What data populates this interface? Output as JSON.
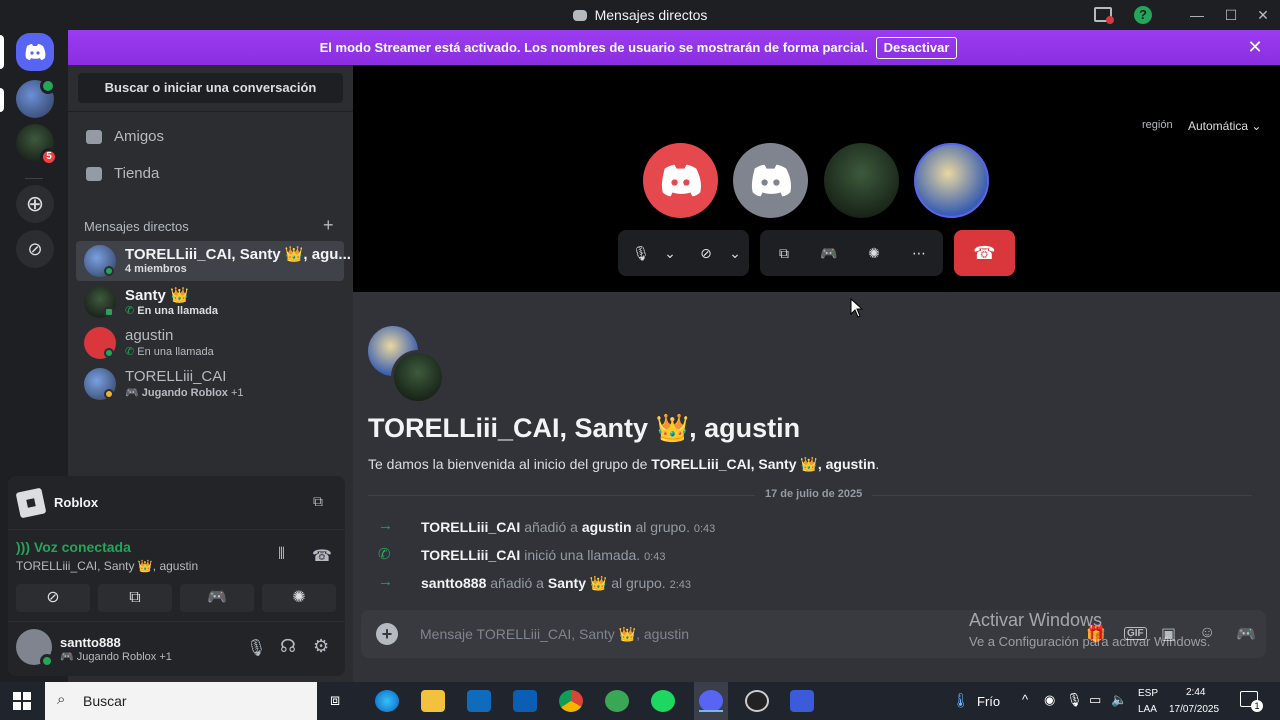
{
  "window": {
    "title": "Mensajes directos",
    "colors": {
      "bg": "#1e1f22",
      "sidebar": "#2b2d31",
      "main": "#313338",
      "accent": "#5865f2",
      "green": "#23a55a",
      "red": "#da373c",
      "banner": "#9b3cf0"
    }
  },
  "banner": {
    "message": "El modo Streamer está activado. Los nombres de usuario se mostrarán de forma parcial.",
    "button": "Desactivar"
  },
  "rail": {
    "unread_badge": "5"
  },
  "sidebar": {
    "search": "Buscar o iniciar una conversación",
    "nav": [
      {
        "label": "Amigos",
        "icon": "friends-icon"
      },
      {
        "label": "Tienda",
        "icon": "shop-icon"
      }
    ],
    "dm_header": "Mensajes directos",
    "dms": [
      {
        "name": "TORELLiii_CAI, Santy 👑, agu...",
        "sub": "4 miembros"
      },
      {
        "name": "Santy 👑",
        "sub": "En una llamada"
      },
      {
        "name": "agustin",
        "sub": "En una llamada"
      },
      {
        "name": "TORELLiii_CAI",
        "sub": "Jugando Roblox",
        "extra": "+1"
      }
    ]
  },
  "panel": {
    "activity": "Roblox",
    "voice_status": "Voz conectada",
    "voice_channel": "TORELLiii_CAI, Santy 👑, agustin",
    "user": {
      "name": "santto888",
      "status": "Jugando Roblox",
      "extra": "+1"
    }
  },
  "call": {
    "region_label": "región",
    "region_value": "Automática"
  },
  "chat": {
    "title": "TORELLiii_CAI, Santy 👑, agustin",
    "welcome_prefix": "Te damos la bienvenida al inicio del grupo de ",
    "welcome_names": "TORELLiii_CAI, Santy 👑, agustin",
    "welcome_suffix": ".",
    "date_divider": "17 de julio de 2025",
    "messages": [
      {
        "actor": "TORELLiii_CAI",
        "verb": "añadió a",
        "target": "agustin",
        "rest": "al grupo.",
        "time": "0:43"
      },
      {
        "actor": "TORELLiii_CAI",
        "verb": "inició una llamada.",
        "target": "",
        "rest": "",
        "time": "0:43"
      },
      {
        "actor": "santto888",
        "verb": "añadió a",
        "target": "Santy 👑",
        "rest": "al grupo.",
        "time": "2:43"
      }
    ],
    "composer_placeholder": "Mensaje TORELLiii_CAI, Santy 👑, agustin"
  },
  "watermark": {
    "line1": "Activar Windows",
    "line2": "Ve a Configuración para activar Windows."
  },
  "taskbar": {
    "search": "Buscar",
    "weather": "Frío",
    "lang1": "ESP",
    "lang2": "LAA",
    "time": "2:44",
    "date": "17/07/2025",
    "notif": "1"
  }
}
